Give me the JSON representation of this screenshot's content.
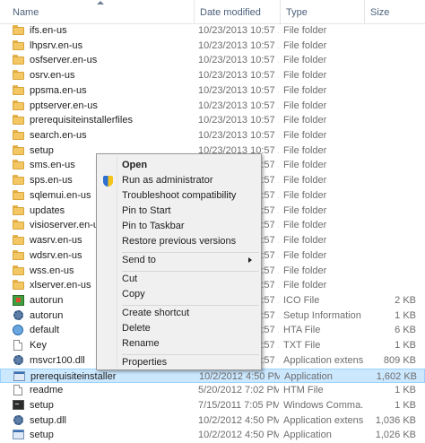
{
  "columns": {
    "name": "Name",
    "date_modified": "Date modified",
    "type": "Type",
    "size": "Size"
  },
  "files": [
    {
      "icon": "folder-icon",
      "name": "ifs.en-us",
      "date": "10/23/2013 10:57 ...",
      "type": "File folder",
      "size": ""
    },
    {
      "icon": "folder-icon",
      "name": "lhpsrv.en-us",
      "date": "10/23/2013 10:57 ...",
      "type": "File folder",
      "size": ""
    },
    {
      "icon": "folder-icon",
      "name": "osfserver.en-us",
      "date": "10/23/2013 10:57 ...",
      "type": "File folder",
      "size": ""
    },
    {
      "icon": "folder-icon",
      "name": "osrv.en-us",
      "date": "10/23/2013 10:57 ...",
      "type": "File folder",
      "size": ""
    },
    {
      "icon": "folder-icon",
      "name": "ppsma.en-us",
      "date": "10/23/2013 10:57 ...",
      "type": "File folder",
      "size": ""
    },
    {
      "icon": "folder-icon",
      "name": "pptserver.en-us",
      "date": "10/23/2013 10:57 ...",
      "type": "File folder",
      "size": ""
    },
    {
      "icon": "folder-icon",
      "name": "prerequisiteinstallerfiles",
      "date": "10/23/2013 10:57 ...",
      "type": "File folder",
      "size": ""
    },
    {
      "icon": "folder-icon",
      "name": "search.en-us",
      "date": "10/23/2013 10:57 ...",
      "type": "File folder",
      "size": ""
    },
    {
      "icon": "folder-icon",
      "name": "setup",
      "date": "10/23/2013 10:57 ...",
      "type": "File folder",
      "size": ""
    },
    {
      "icon": "folder-icon",
      "name": "sms.en-us",
      "date": "10/23/2013 10:57 ...",
      "type": "File folder",
      "size": ""
    },
    {
      "icon": "folder-icon",
      "name": "sps.en-us",
      "date": "10/23/2013 10:57 ...",
      "type": "File folder",
      "size": ""
    },
    {
      "icon": "folder-icon",
      "name": "sqlemui.en-us",
      "date": "10/23/2013 10:57 ...",
      "type": "File folder",
      "size": ""
    },
    {
      "icon": "folder-icon",
      "name": "updates",
      "date": "10/23/2013 10:57 ...",
      "type": "File folder",
      "size": ""
    },
    {
      "icon": "folder-icon",
      "name": "visioserver.en-us",
      "date": "10/23/2013 10:57 ...",
      "type": "File folder",
      "size": ""
    },
    {
      "icon": "folder-icon",
      "name": "wasrv.en-us",
      "date": "10/23/2013 10:57 ...",
      "type": "File folder",
      "size": ""
    },
    {
      "icon": "folder-icon",
      "name": "wdsrv.en-us",
      "date": "10/23/2013 10:57 ...",
      "type": "File folder",
      "size": ""
    },
    {
      "icon": "folder-icon",
      "name": "wss.en-us",
      "date": "10/23/2013 10:57 ...",
      "type": "File folder",
      "size": ""
    },
    {
      "icon": "folder-icon",
      "name": "xlserver.en-us",
      "date": "10/23/2013 10:57 ...",
      "type": "File folder",
      "size": ""
    },
    {
      "icon": "ico-file-icon",
      "name": "autorun",
      "date": "10/23/2013 10:57 ...",
      "type": "ICO File",
      "size": "2 KB"
    },
    {
      "icon": "setup-information-icon",
      "name": "autorun",
      "date": "10/23/2013 10:57 ...",
      "type": "Setup Information",
      "size": "1 KB"
    },
    {
      "icon": "hta-file-icon",
      "name": "default",
      "date": "10/23/2013 10:57 ...",
      "type": "HTA File",
      "size": "6 KB"
    },
    {
      "icon": "text-file-icon",
      "name": "Key",
      "date": "10/23/2013 10:57 ...",
      "type": "TXT File",
      "size": "1 KB"
    },
    {
      "icon": "dll-file-icon",
      "name": "msvcr100.dll",
      "date": "10/23/2013 10:57 ...",
      "type": "Application extens...",
      "size": "809 KB"
    },
    {
      "icon": "application-icon",
      "name": "prerequisiteinstaller",
      "date": "10/2/2012 4:50 PM",
      "type": "Application",
      "size": "1,602 KB",
      "selected": true
    },
    {
      "icon": "htm-file-icon",
      "name": "readme",
      "date": "5/20/2012 7:02 PM",
      "type": "HTM File",
      "size": "1 KB"
    },
    {
      "icon": "command-script-icon",
      "name": "setup",
      "date": "7/15/2011 7:05 PM",
      "type": "Windows Comma...",
      "size": "1 KB"
    },
    {
      "icon": "dll-file-icon",
      "name": "setup.dll",
      "date": "10/2/2012 4:50 PM",
      "type": "Application extens...",
      "size": "1,036 KB"
    },
    {
      "icon": "application-icon",
      "name": "setup",
      "date": "10/2/2012 4:50 PM",
      "type": "Application",
      "size": "1,026 KB"
    }
  ],
  "context_menu": {
    "open": "Open",
    "run_as_admin": "Run as administrator",
    "troubleshoot": "Troubleshoot compatibility",
    "pin_start": "Pin to Start",
    "pin_taskbar": "Pin to Taskbar",
    "restore_versions": "Restore previous versions",
    "send_to": "Send to",
    "cut": "Cut",
    "copy": "Copy",
    "create_shortcut": "Create shortcut",
    "delete": "Delete",
    "rename": "Rename",
    "properties": "Properties"
  },
  "colors": {
    "header_text": "#4c607a",
    "selection_bg": "#cce8ff",
    "selection_border": "#99d1ff",
    "menu_bg": "#f0f0f0"
  }
}
